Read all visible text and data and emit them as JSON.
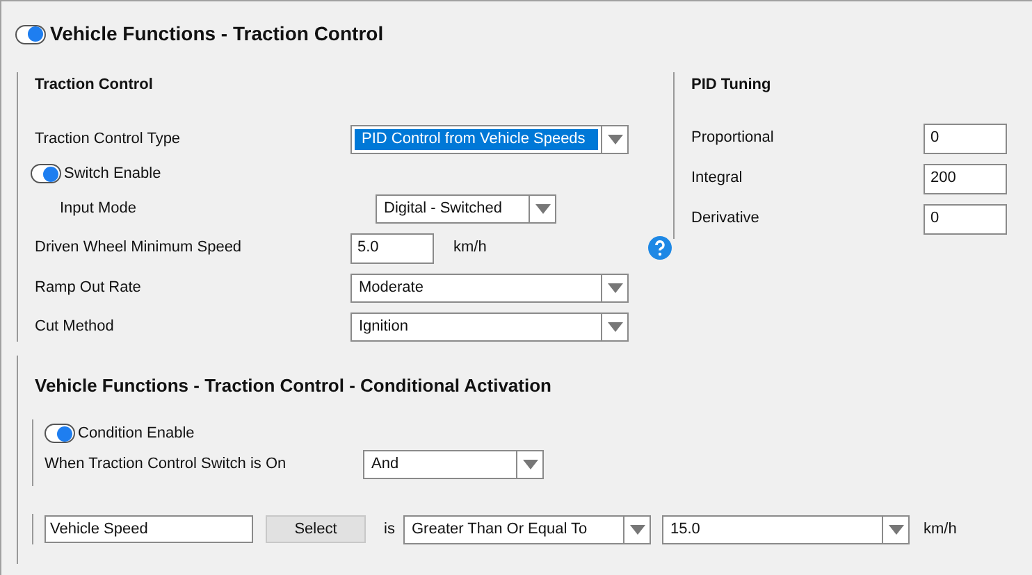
{
  "title": {
    "text": "Vehicle Functions - Traction Control",
    "on": true
  },
  "traction_control": {
    "heading": "Traction Control",
    "rows": [
      {
        "kind": "dropdown",
        "label": "Traction Control Type",
        "value": "PID Control from Vehicle Speeds",
        "focused": true
      },
      {
        "kind": "toggle",
        "label": "Switch Enable",
        "on": true,
        "children": [
          {
            "kind": "dropdown",
            "label": "Input Mode",
            "value": "Digital - Switched",
            "focused": false
          }
        ]
      },
      {
        "kind": "number",
        "label": "Driven Wheel Minimum Speed",
        "value": "5.0",
        "unit": "km/h",
        "help": true
      },
      {
        "kind": "dropdown",
        "label": "Ramp Out Rate",
        "value": "Moderate",
        "focused": false
      },
      {
        "kind": "dropdown",
        "label": "Cut Method",
        "value": "Ignition",
        "focused": false
      }
    ]
  },
  "pid_tuning": {
    "heading": "PID Tuning",
    "rows": [
      {
        "label": "Proportional",
        "value": "0"
      },
      {
        "label": "Integral",
        "value": "200"
      },
      {
        "label": "Derivative",
        "value": "0"
      }
    ]
  },
  "conditional_activation": {
    "heading": "Vehicle Functions - Traction Control - Conditional Activation",
    "condition_enable": {
      "label": "Condition Enable",
      "on": true
    },
    "switch_row": {
      "label": "When Traction Control Switch is On",
      "value": "And"
    },
    "condition": {
      "channel": "Vehicle Speed",
      "select_button": "Select",
      "is": "is",
      "operator": "Greater Than Or Equal To",
      "value": "15.0",
      "unit": "km/h"
    }
  }
}
